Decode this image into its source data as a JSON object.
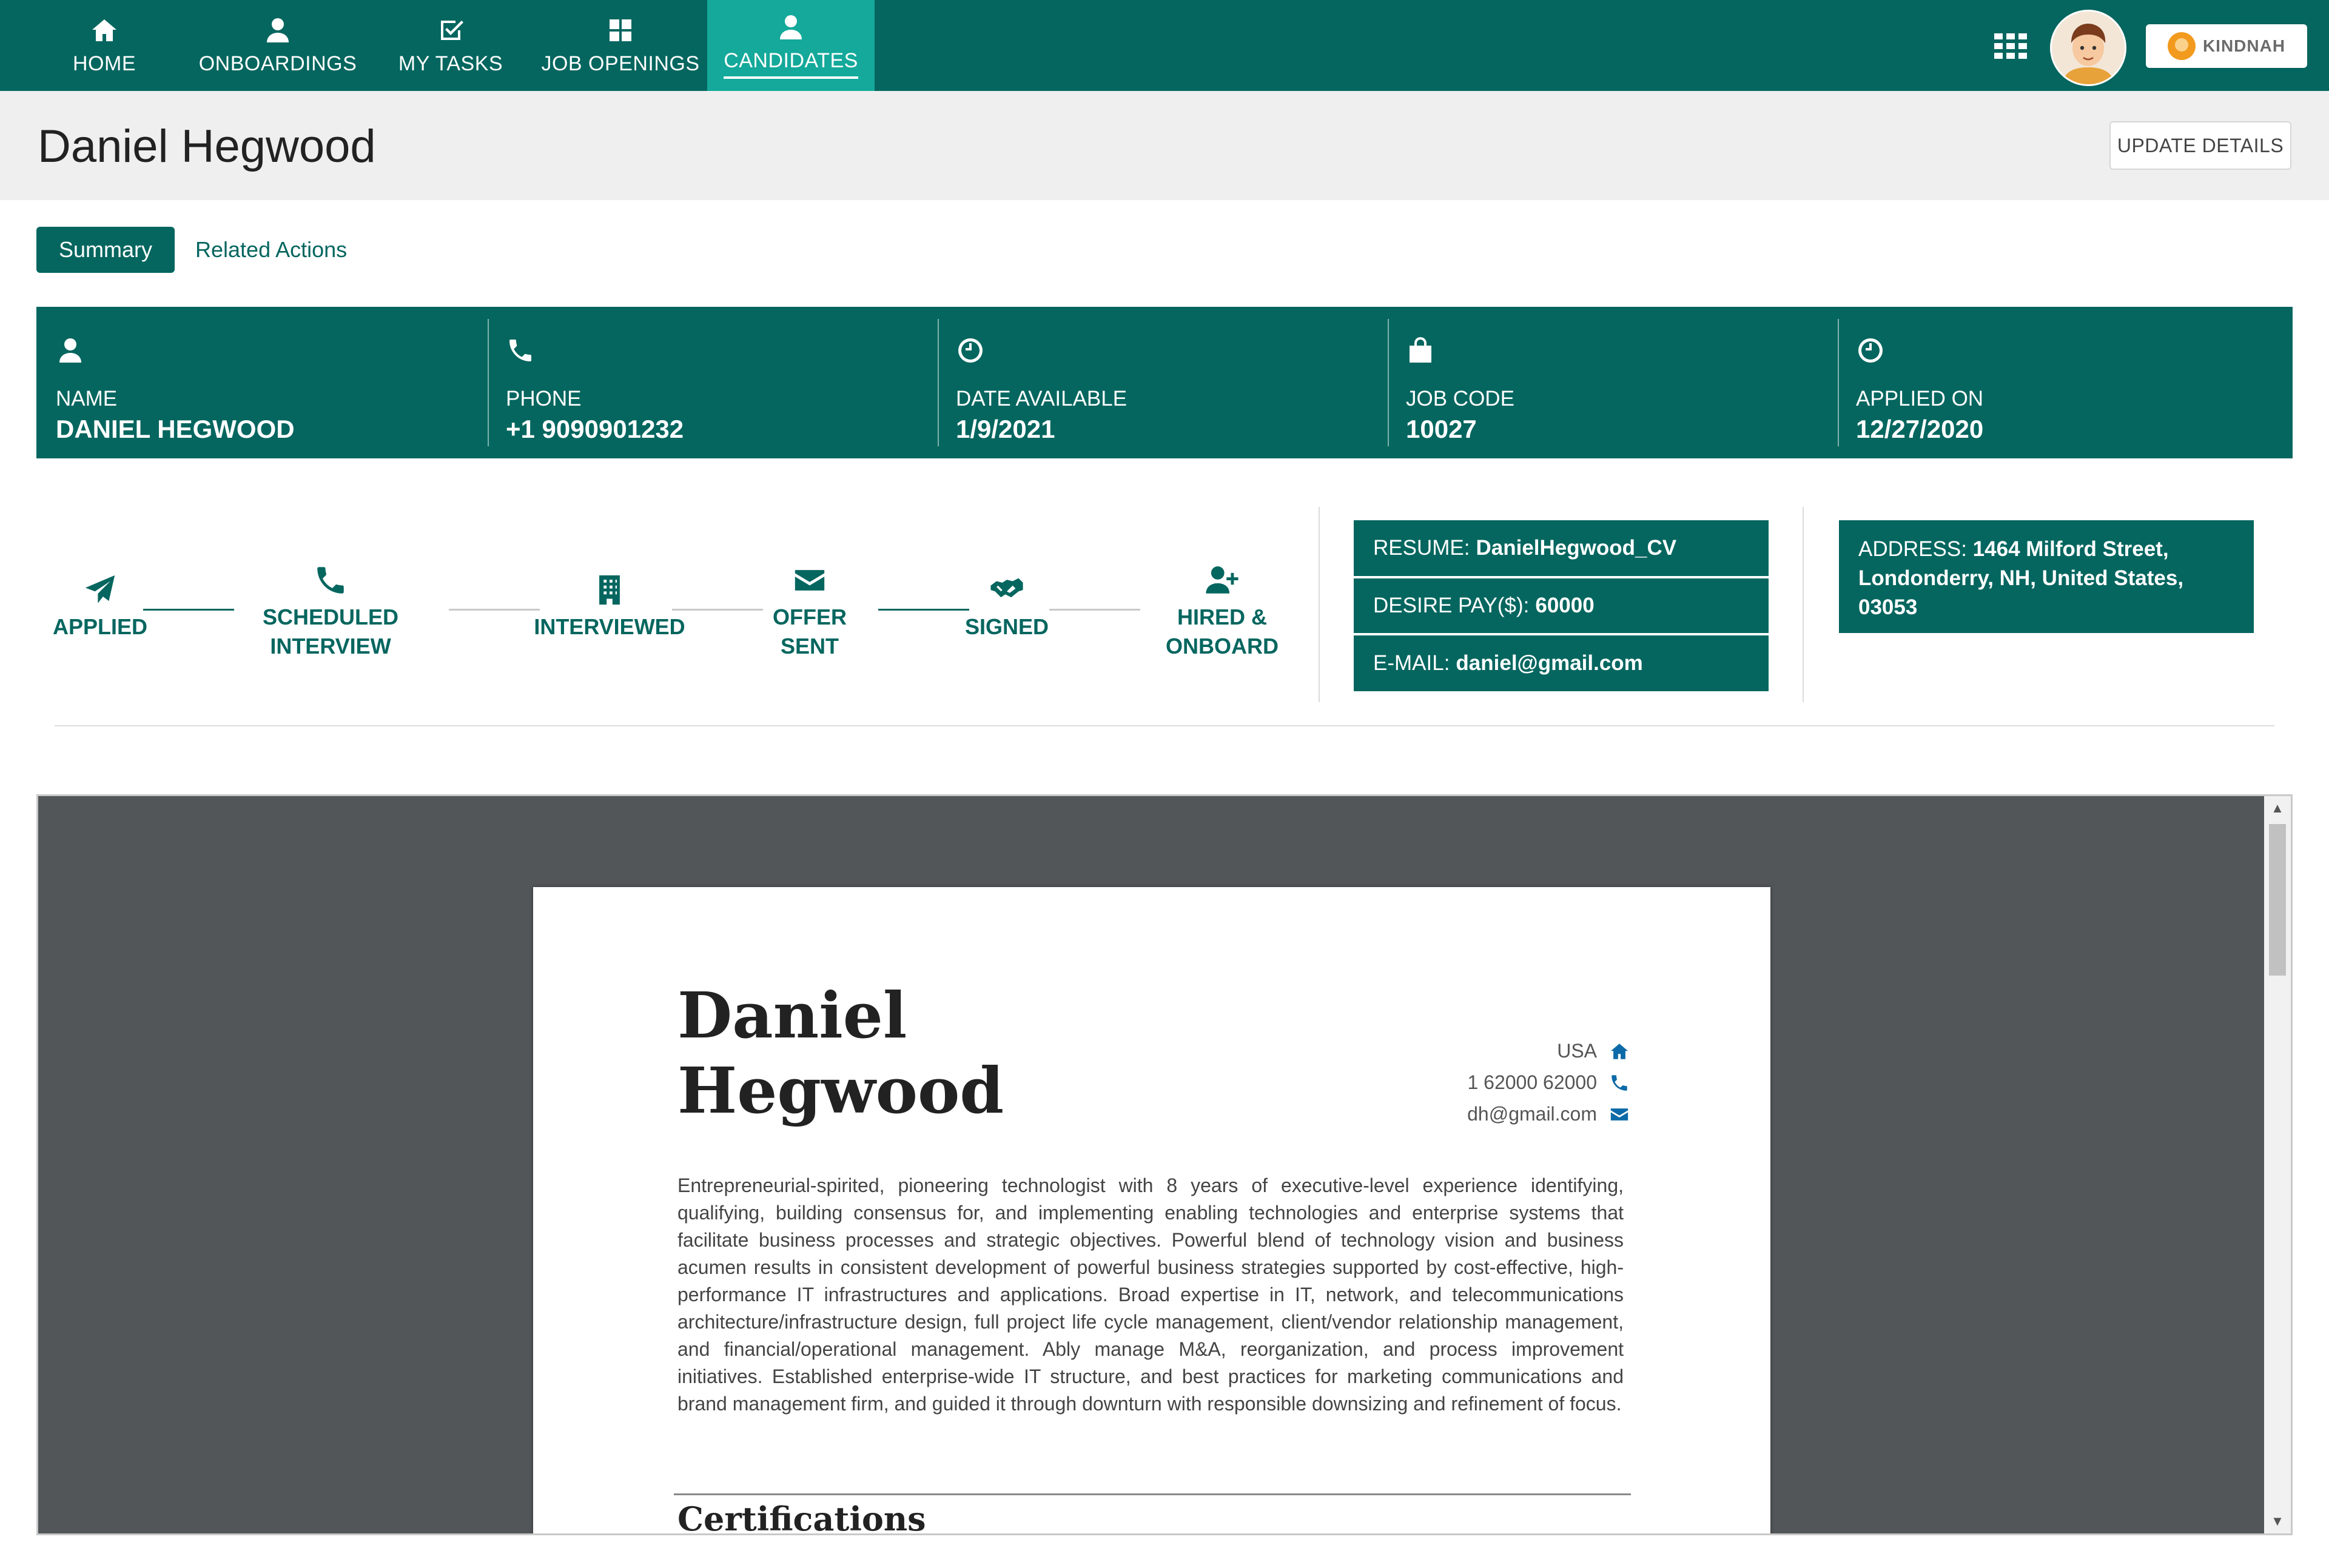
{
  "nav": {
    "items": [
      {
        "label": "HOME",
        "icon": "home-icon"
      },
      {
        "label": "ONBOARDINGS",
        "icon": "user-icon"
      },
      {
        "label": "MY TASKS",
        "icon": "check-square-icon"
      },
      {
        "label": "JOB OPENINGS",
        "icon": "grid-icon"
      },
      {
        "label": "CANDIDATES",
        "icon": "user-icon",
        "active": true
      }
    ],
    "brand": "KINDNAH"
  },
  "header": {
    "title": "Daniel Hegwood",
    "update_label": "UPDATE DETAILS"
  },
  "tabs": [
    {
      "label": "Summary",
      "active": true
    },
    {
      "label": "Related Actions",
      "active": false
    }
  ],
  "info": {
    "name": {
      "label": "NAME",
      "value": "DANIEL HEGWOOD"
    },
    "phone": {
      "label": "PHONE",
      "value": "+1 9090901232"
    },
    "date_available": {
      "label": "DATE AVAILABLE",
      "value": "1/9/2021"
    },
    "job_code": {
      "label": "JOB CODE",
      "value": "10027"
    },
    "applied_on": {
      "label": "APPLIED ON",
      "value": "12/27/2020"
    }
  },
  "pipeline": {
    "stages": [
      {
        "line1": "APPLIED",
        "line2": ""
      },
      {
        "line1": "SCHEDULED",
        "line2": "INTERVIEW"
      },
      {
        "line1": "INTERVIEWED",
        "line2": ""
      },
      {
        "line1": "OFFER",
        "line2": "SENT"
      },
      {
        "line1": "SIGNED",
        "line2": ""
      },
      {
        "line1": "HIRED &",
        "line2": "ONBOARD"
      }
    ]
  },
  "details": {
    "resume_label": "RESUME:",
    "resume_value": "DanielHegwood_CV",
    "pay_label": "DESIRE PAY($):",
    "pay_value": "60000",
    "email_label": "E-MAIL:",
    "email_value": "daniel@gmail.com",
    "address_label": "ADDRESS:",
    "address_value": "1464 Milford Street, Londonderry, NH, United States, 03053"
  },
  "resume_doc": {
    "name_line1": "Daniel",
    "name_line2": "Hegwood",
    "country": "USA",
    "phone": "1 62000 62000",
    "email": "dh@gmail.com",
    "summary": "Entrepreneurial-spirited, pioneering technologist with 8 years of executive-level experience identifying, qualifying, building consensus for, and implementing enabling technologies and enterprise systems that facilitate business processes and strategic objectives. Powerful blend of technology vision and business acumen results in consistent development of powerful business strategies supported by cost-effective, high-performance IT infrastructures and applications. Broad expertise in IT, network, and telecommunications architecture/infrastructure design, full project life cycle management, client/vendor relationship management, and financial/operational management. Ably manage M&A, reorganization, and process improvement initiatives. Established enterprise-wide IT structure, and best practices for marketing communications and brand management firm, and guided it through downturn with responsible downsizing and refinement of focus.",
    "section_title": "Certifications"
  }
}
